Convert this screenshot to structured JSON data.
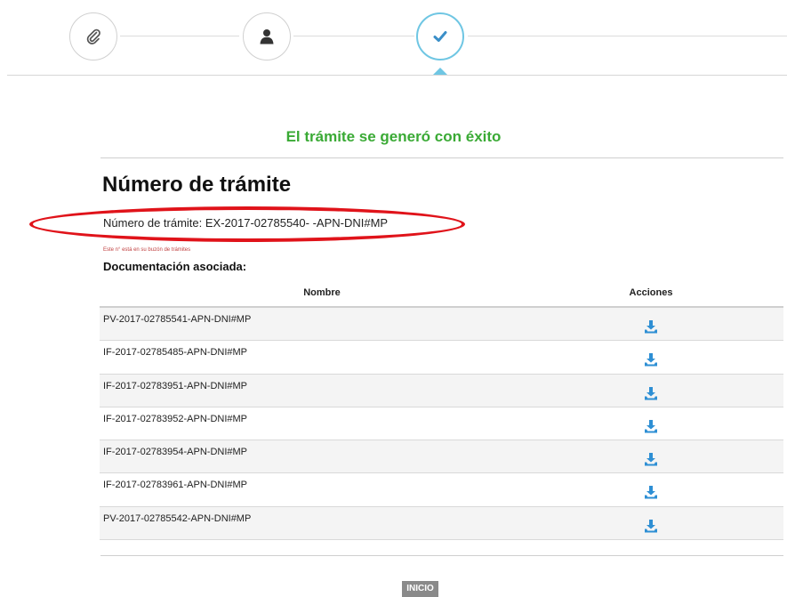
{
  "stepper": {
    "steps": [
      {
        "icon": "paperclip-icon",
        "state": "done"
      },
      {
        "icon": "user-icon",
        "state": "done"
      },
      {
        "icon": "checkmark-icon",
        "state": "active"
      }
    ],
    "accent_color": "#6fc6e3"
  },
  "status": {
    "message": "El trámite se generó con éxito",
    "color": "#3aaa35"
  },
  "main": {
    "title": "Número de trámite",
    "tramite_text": "Número de trámite: EX-2017-02785540- -APN-DNI#MP",
    "note": "Este n° está en su buzón de trámites",
    "doc_heading": "Documentación asociada:"
  },
  "table": {
    "headers": {
      "nombre": "Nombre",
      "acciones": "Acciones"
    },
    "rows": [
      {
        "nombre": "PV-2017-02785541-APN-DNI#MP",
        "action_icon": "download-icon"
      },
      {
        "nombre": "IF-2017-02785485-APN-DNI#MP",
        "action_icon": "download-icon"
      },
      {
        "nombre": "IF-2017-02783951-APN-DNI#MP",
        "action_icon": "download-icon"
      },
      {
        "nombre": "IF-2017-02783952-APN-DNI#MP",
        "action_icon": "download-icon"
      },
      {
        "nombre": "IF-2017-02783954-APN-DNI#MP",
        "action_icon": "download-icon"
      },
      {
        "nombre": "IF-2017-02783961-APN-DNI#MP",
        "action_icon": "download-icon"
      },
      {
        "nombre": "PV-2017-02785542-APN-DNI#MP",
        "action_icon": "download-icon"
      }
    ]
  },
  "footer": {
    "inicio_label": "INICIO"
  },
  "annotation": {
    "color": "#e0131a"
  }
}
